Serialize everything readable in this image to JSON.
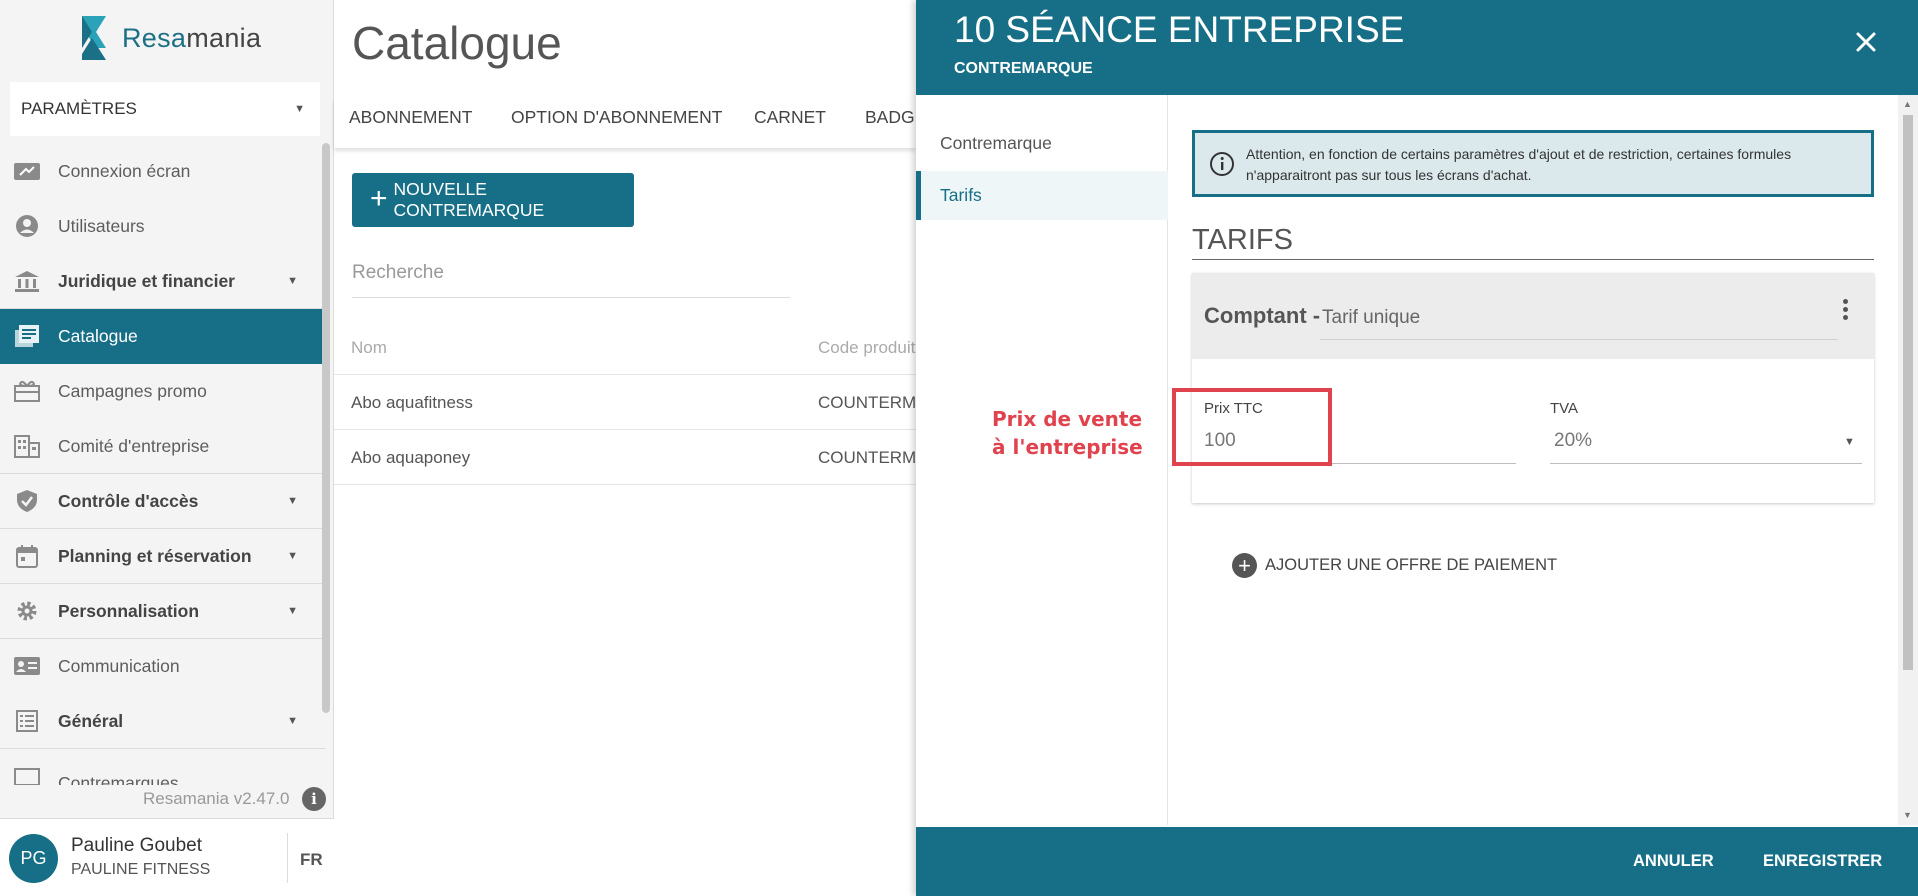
{
  "app": {
    "brand_prefix": "Resa",
    "brand_suffix": "mania",
    "version": "Resamania v2.47.0"
  },
  "sidebar": {
    "section_selector": "PARAMÈTRES",
    "items": [
      {
        "label": "Connexion écran",
        "icon": "screen-connect-icon"
      },
      {
        "label": "Utilisateurs",
        "icon": "user-icon"
      },
      {
        "label": "Juridique et financier",
        "icon": "bank-icon"
      },
      {
        "label": "Catalogue",
        "icon": "catalog-icon"
      },
      {
        "label": "Campagnes promo",
        "icon": "gift-icon"
      },
      {
        "label": "Comité d'entreprise",
        "icon": "building-icon"
      },
      {
        "label": "Contrôle d'accès",
        "icon": "shield-icon"
      },
      {
        "label": "Planning et réservation",
        "icon": "calendar-icon"
      },
      {
        "label": "Personnalisation",
        "icon": "gear-icon"
      },
      {
        "label": "Communication",
        "icon": "contact-card-icon"
      },
      {
        "label": "Général",
        "icon": "list-icon"
      },
      {
        "label": "Contremarques",
        "icon": "ticket-icon"
      }
    ]
  },
  "user": {
    "initials": "PG",
    "name": "Pauline Goubet",
    "org": "PAULINE FITNESS",
    "lang": "FR"
  },
  "catalogue": {
    "title": "Catalogue",
    "tabs": [
      "ABONNEMENT",
      "OPTION D'ABONNEMENT",
      "CARNET",
      "BADGE"
    ],
    "new_button": "NOUVELLE CONTREMARQUE",
    "search_placeholder": "Recherche",
    "columns": [
      "Nom",
      "Code produit"
    ],
    "rows": [
      {
        "name": "Abo aquafitness",
        "code": "COUNTERMA"
      },
      {
        "name": "Abo aquaponey",
        "code": "COUNTERMA"
      }
    ]
  },
  "drawer": {
    "title": "10 SÉANCE ENTREPRISE",
    "subtitle": "CONTREMARQUE",
    "side_tabs": [
      "Contremarque",
      "Tarifs"
    ],
    "alert": "Attention, en fonction de certains paramètres d'ajout et de restriction, certaines formules n'apparaitront pas sur tous les écrans d'achat.",
    "section_title": "TARIFS",
    "card": {
      "title": "Comptant -",
      "subtitle": "Tarif unique",
      "price_label": "Prix TTC",
      "price_value": "100",
      "tva_label": "TVA",
      "tva_value": "20%"
    },
    "annotation": "Prix de vente à l'entreprise",
    "add_offer": "AJOUTER UNE OFFRE DE PAIEMENT",
    "cancel": "ANNULER",
    "save": "ENREGISTRER"
  },
  "colors": {
    "primary": "#176f87",
    "annotation": "#e0434d",
    "alert_bg": "#dbe9ed"
  }
}
